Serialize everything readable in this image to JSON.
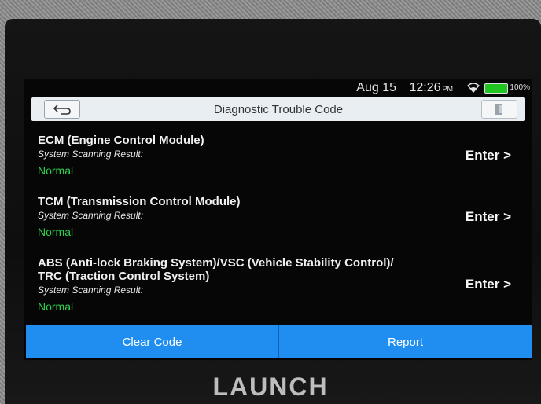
{
  "statusbar": {
    "date": "Aug 15",
    "time": "12:26",
    "ampm": "PM",
    "battery": "100%",
    "icons": [
      "wifi-icon",
      "battery-icon"
    ]
  },
  "titlebar": {
    "title": "Diagnostic Trouble Code",
    "icons": [
      "back-arrow-icon",
      "exit-icon"
    ]
  },
  "modules": [
    {
      "name": "ECM (Engine Control Module)",
      "result_label": "System Scanning Result:",
      "result_value": "Normal",
      "enter_label": "Enter >"
    },
    {
      "name": "TCM (Transmission Control Module)",
      "result_label": "System Scanning Result:",
      "result_value": "Normal",
      "enter_label": "Enter >"
    },
    {
      "name": "ABS (Anti-lock Braking System)/VSC (Vehicle Stability Control)/ TRC (Traction Control System)",
      "result_label": "System Scanning Result:",
      "result_value": "Normal",
      "enter_label": "Enter >"
    }
  ],
  "actions": {
    "clear_code": "Clear Code",
    "report": "Report"
  },
  "brand": "LAUNCH",
  "colors": {
    "accent": "#1f8ef0",
    "status_normal": "#2ed14a",
    "titlebar_bg": "#e9eef3"
  }
}
